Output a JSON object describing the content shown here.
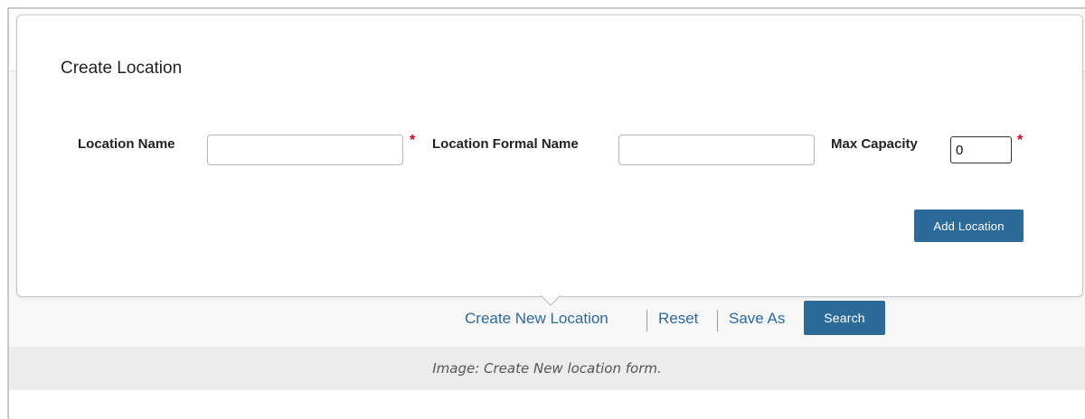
{
  "popup": {
    "title": "Create Location",
    "fields": {
      "location_name": {
        "label": "Location Name",
        "value": "",
        "required": true
      },
      "formal_name": {
        "label": "Location Formal Name",
        "value": ""
      },
      "max_capacity": {
        "label": "Max Capacity",
        "value": "0",
        "required": true
      }
    },
    "required_marker": "*",
    "add_button": "Add Location"
  },
  "actions": {
    "create_new": "Create New Location",
    "reset": "Reset",
    "save_as": "Save As",
    "search": "Search"
  },
  "caption": "Image: Create New location form.",
  "colors": {
    "primary": "#2c6a9a",
    "required": "#d0021b",
    "caption_bg": "#ececec"
  }
}
